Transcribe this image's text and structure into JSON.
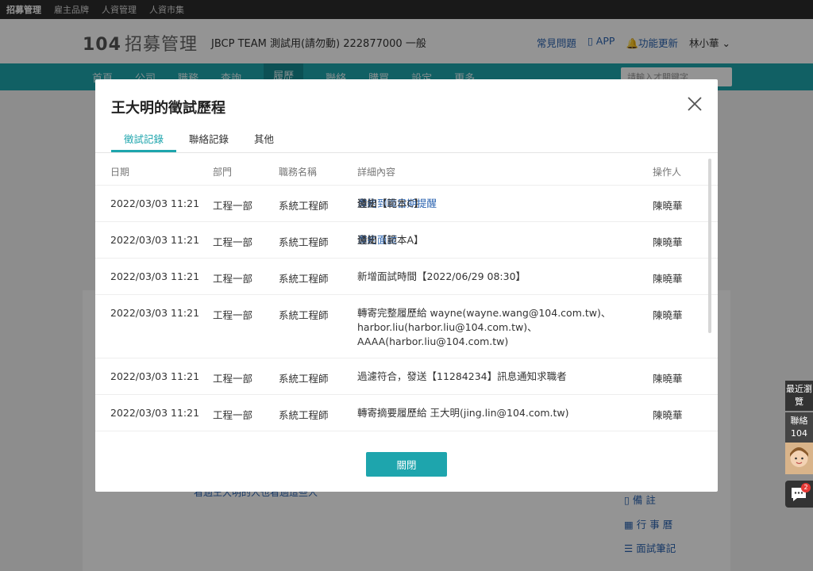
{
  "topbar": {
    "items": [
      "招募管理",
      "雇主品牌",
      "人資管理",
      "人資市集"
    ]
  },
  "header": {
    "logo_num": "104",
    "logo_brand": "招募管理",
    "company": "JBCP TEAM 測試用(請勿動) 222877000 一般",
    "faq": "常見問題",
    "app": "APP",
    "update": "功能更新",
    "user": "林小華"
  },
  "nav": {
    "items": [
      "首頁",
      "公司",
      "職務",
      "查詢",
      "履歷",
      "聯絡",
      "購買",
      "設定",
      "更多"
    ],
    "search_placeholder": "請輸入才關鍵字"
  },
  "modal": {
    "title": "王大明的徵試歷程",
    "tabs": [
      "徵試記錄",
      "聯絡記錄",
      "其他"
    ],
    "columns": [
      "日期",
      "部門",
      "職務名稱",
      "詳細內容",
      "操作人"
    ],
    "rows": [
      {
        "date": "2022/03/03 11:21",
        "dept": "工程一部",
        "title": "系統工程師",
        "pre": "發出",
        "link": "邀約到職日期提醒",
        "post": "通知【範本C】",
        "op": "陳曉華"
      },
      {
        "date": "2022/03/03 11:21",
        "dept": "工程一部",
        "title": "系統工程師",
        "pre": "發出",
        "link": "邀約面試",
        "post": "通知【範本A】",
        "op": "陳曉華"
      },
      {
        "date": "2022/03/03 11:21",
        "dept": "工程一部",
        "title": "系統工程師",
        "pre": "新增面試時間【2022/06/29 08:30】",
        "link": "",
        "post": "",
        "op": "陳曉華"
      },
      {
        "date": "2022/03/03 11:21",
        "dept": "工程一部",
        "title": "系統工程師",
        "pre": "轉寄完整履歷給 wayne(wayne.wang@104.com.tw)、harbor.liu(harbor.liu@104.com.tw)、AAAA(harbor.liu@104.com.tw)",
        "link": "",
        "post": "",
        "op": "陳曉華"
      },
      {
        "date": "2022/03/03 11:21",
        "dept": "工程一部",
        "title": "系統工程師",
        "pre": "過濾符合，發送【11284234】訊息通知求職者",
        "link": "",
        "post": "",
        "op": "陳曉華"
      },
      {
        "date": "2022/03/03 11:21",
        "dept": "工程一部",
        "title": "系統工程師",
        "pre": "轉寄摘要履歷給 王大明(jing.lin@104.com.tw)",
        "link": "",
        "post": "",
        "op": "陳曉華"
      }
    ],
    "close_label": "關閉"
  },
  "background": {
    "note_link": "看過王大明的人也看過這些人",
    "side": [
      "備 註",
      "行 事 曆",
      "面試筆記"
    ]
  },
  "float": {
    "recent": "最近瀏覽",
    "contact": "聯絡104",
    "badge": "2"
  }
}
